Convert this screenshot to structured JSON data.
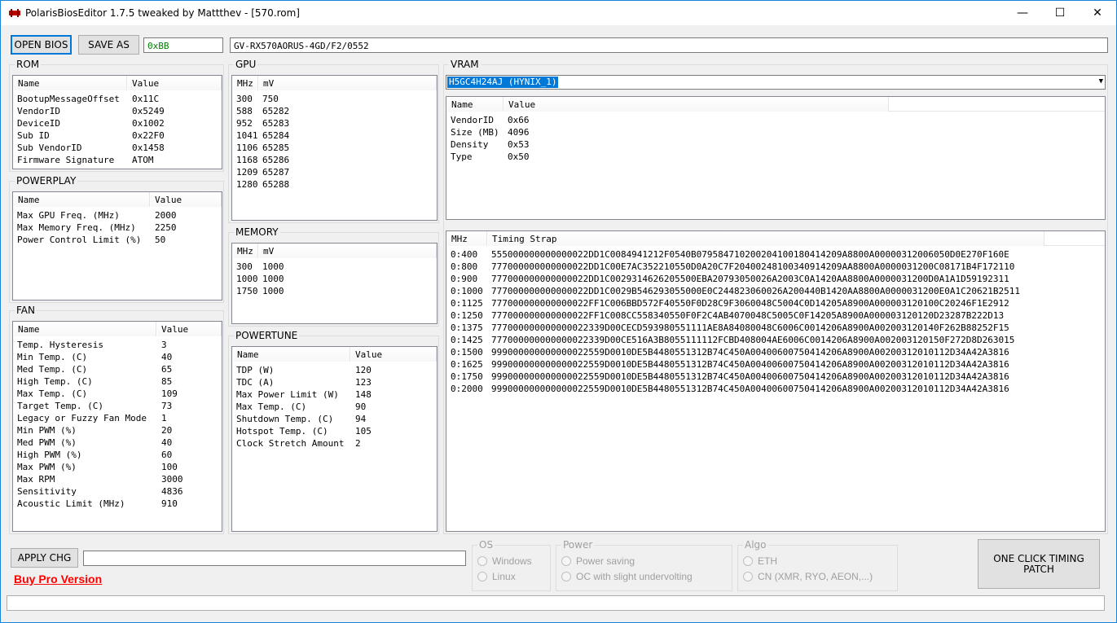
{
  "window": {
    "title": "PolarisBiosEditor 1.7.5 tweaked by Mattthev  - [570.rom]",
    "minimize": "—",
    "maximize": "☐",
    "close": "✕"
  },
  "toolbar": {
    "open_bios": "OPEN BIOS",
    "save_as": "SAVE AS",
    "checksum": "0xBB",
    "bios_name": "GV-RX570AORUS-4GD/F2/0552"
  },
  "rom": {
    "title": "ROM",
    "columns": [
      "Name",
      "Value"
    ],
    "rows": [
      [
        "BootupMessageOffset",
        "0x11C"
      ],
      [
        "VendorID",
        "0x5249"
      ],
      [
        "DeviceID",
        "0x1002"
      ],
      [
        "Sub ID",
        "0x22F0"
      ],
      [
        "Sub VendorID",
        "0x1458"
      ],
      [
        "Firmware Signature",
        "ATOM"
      ]
    ]
  },
  "powerplay": {
    "title": "POWERPLAY",
    "columns": [
      "Name",
      "Value"
    ],
    "rows": [
      [
        "Max GPU Freq. (MHz)",
        "2000"
      ],
      [
        "Max Memory Freq. (MHz)",
        "2250"
      ],
      [
        "Power Control Limit (%)",
        "50"
      ]
    ]
  },
  "fan": {
    "title": "FAN",
    "columns": [
      "Name",
      "Value"
    ],
    "rows": [
      [
        "Temp. Hysteresis",
        "3"
      ],
      [
        "Min Temp. (C)",
        "40"
      ],
      [
        "Med Temp. (C)",
        "65"
      ],
      [
        "High Temp. (C)",
        "85"
      ],
      [
        "Max Temp. (C)",
        "109"
      ],
      [
        "Target Temp. (C)",
        "73"
      ],
      [
        "Legacy or Fuzzy Fan Mode",
        "1"
      ],
      [
        "Min PWM (%)",
        "20"
      ],
      [
        "Med PWM (%)",
        "40"
      ],
      [
        "High PWM (%)",
        "60"
      ],
      [
        "Max PWM (%)",
        "100"
      ],
      [
        "Max RPM",
        "3000"
      ],
      [
        "Sensitivity",
        "4836"
      ],
      [
        "Acoustic Limit (MHz)",
        "910"
      ]
    ]
  },
  "gpu": {
    "title": "GPU",
    "columns": [
      "MHz",
      "mV"
    ],
    "rows": [
      [
        "300",
        "750"
      ],
      [
        "588",
        "65282"
      ],
      [
        "952",
        "65283"
      ],
      [
        "1041",
        "65284"
      ],
      [
        "1106",
        "65285"
      ],
      [
        "1168",
        "65286"
      ],
      [
        "1209",
        "65287"
      ],
      [
        "1280",
        "65288"
      ]
    ]
  },
  "memory": {
    "title": "MEMORY",
    "columns": [
      "MHz",
      "mV"
    ],
    "rows": [
      [
        "300",
        "1000"
      ],
      [
        "1000",
        "1000"
      ],
      [
        "1750",
        "1000"
      ]
    ]
  },
  "powertune": {
    "title": "POWERTUNE",
    "columns": [
      "Name",
      "Value"
    ],
    "rows": [
      [
        "TDP (W)",
        "120"
      ],
      [
        "TDC (A)",
        "123"
      ],
      [
        "Max Power Limit (W)",
        "148"
      ],
      [
        "Max Temp. (C)",
        "90"
      ],
      [
        "Shutdown Temp. (C)",
        "94"
      ],
      [
        "Hotspot Temp. (C)",
        "105"
      ],
      [
        "Clock Stretch Amount",
        "2"
      ]
    ]
  },
  "vram": {
    "title": "VRAM",
    "selected_chip": "H5GC4H24AJ (HYNIX_1)",
    "columns": [
      "Name",
      "Value"
    ],
    "rows": [
      [
        "VendorID",
        "0x66"
      ],
      [
        "Size (MB)",
        "4096"
      ],
      [
        "Density",
        "0x53"
      ],
      [
        "Type",
        "0x50"
      ]
    ]
  },
  "timings": {
    "columns": [
      "MHz",
      "Timing Strap"
    ],
    "rows": [
      [
        "0:400",
        "555000000000000022DD1C0084941212F0540B079584710200204100180414209A8800A00000312006050D0E270F160E"
      ],
      [
        "0:800",
        "777000000000000022DD1C00E7AC352210550D0A20C7F2040024810034091420​9AA8800A0000031200C08171B4F172110"
      ],
      [
        "0:900",
        "777000000000000022DD1C0029314626205500EBA20793050026A2003C0A1420AA8800A0000031200D0A1A1D59192311"
      ],
      [
        "0:1000",
        "777000000000000022DD1C0029B546293055000E0C24482306002​6A200440B1420AA8800A0000031200E0A1C20621B2511"
      ],
      [
        "0:1125",
        "777000000000000022FF1C006BBD572F40550F0D28C9F3060048C5004C0D14205A8900A000003120100C20246F1E2912"
      ],
      [
        "0:1250",
        "777000000000000022FF1C008CC558340550F0F2C4AB4070048C5005C0F14205A8900A00000312012​0D23287B222D13"
      ],
      [
        "0:1375",
        "777000000000000022339D00CECD5939805511​11AE8A84080048C6006C0014206A8900A002003120140F262B88252F15"
      ],
      [
        "0:1425",
        "777000000000000022339D00CE516A3B805511​1112FCBD408004AE6006C0014206A8900A00200312​0150F272D8D263015"
      ],
      [
        "0:1500",
        "999000000000000022559D0010DE5B4480551312B74C450A004006007504​14206A8900A00200312010112D34A42A3816"
      ],
      [
        "0:1625",
        "999000000000000022559D0010DE5B4480551312B74C450A004006007504​14206A8900A00200312010112D34A42A3816"
      ],
      [
        "0:1750",
        "999000000000000022559D0010DE5B4480551312B74C450A004006007504​14206A8900A00200312010112D34A42A3816"
      ],
      [
        "0:2000",
        "999000000000000022559D0010DE5B4480551312B74C450A004006007504​14206A8900A00200312010112D34A42A3816"
      ]
    ]
  },
  "bottom": {
    "apply": "APPLY CHG",
    "buy_pro": "Buy Pro Version",
    "one_click": "ONE CLICK TIMING PATCH",
    "os_title": "OS",
    "os_windows": "Windows",
    "os_linux": "Linux",
    "power_title": "Power",
    "power_saving": "Power saving",
    "power_oc": "OC with slight undervolting",
    "algo_title": "Algo",
    "algo_eth": "ETH",
    "algo_cn": "CN (XMR, RYO, AEON,...)"
  }
}
